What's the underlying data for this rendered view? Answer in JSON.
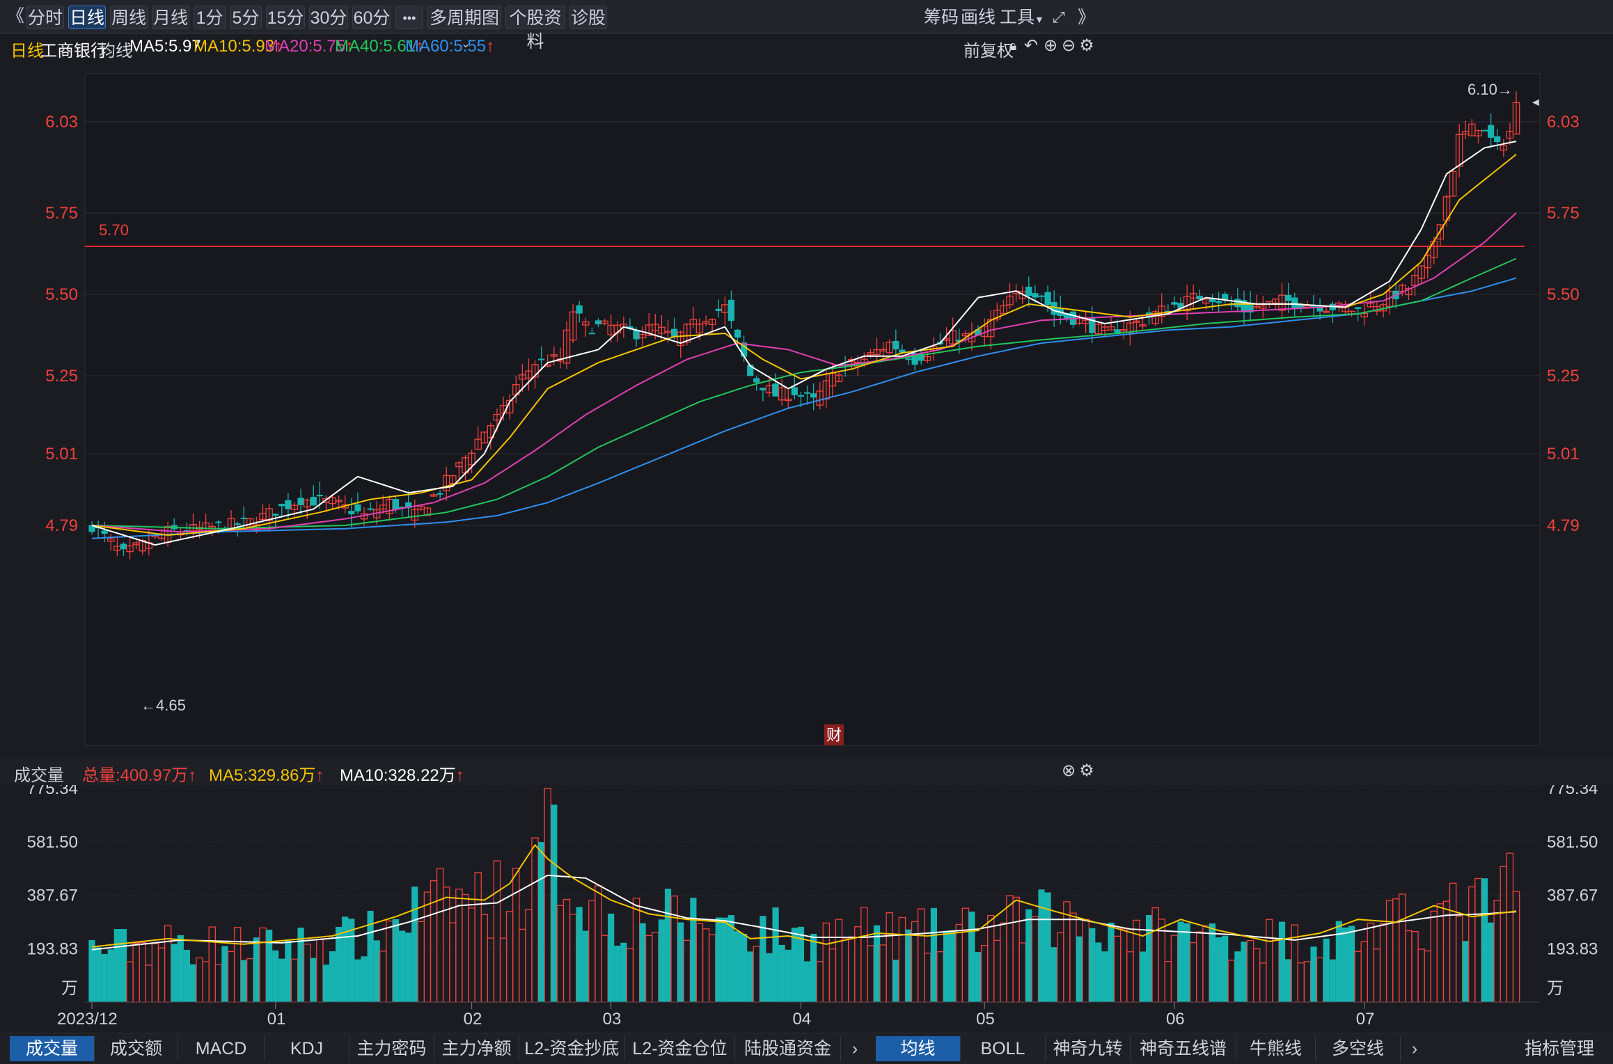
{
  "toolbar": {
    "back_icon": "double-chevron-left",
    "periods": [
      "分时",
      "日线",
      "周线",
      "月线",
      "1分",
      "5分",
      "15分",
      "30分",
      "60分"
    ],
    "active_period": "日线",
    "more": "•••",
    "multi": "多周期图",
    "profile": "个股资料",
    "diagnose": "诊股",
    "right": {
      "chips": "筹码",
      "draw": "画线",
      "tools": "工具"
    }
  },
  "info": {
    "period": "日线",
    "name": "工商银行",
    "ma_label": "均线",
    "ma5": "MA5:5.97",
    "ma10": "MA10:5.93",
    "ma20": "MA20:5.75",
    "ma40": "MA40:5.61",
    "ma60": "MA60:5.55",
    "adjust": "前复权"
  },
  "price_panel": {
    "y_labels": [
      "6.03",
      "5.75",
      "5.50",
      "5.25",
      "5.01",
      "4.79"
    ],
    "hline_label": "5.70",
    "high_label": "6.10→",
    "low_label": "←4.65",
    "fin_badge": "财"
  },
  "volume_bar": {
    "title": "成交量",
    "total": "总量:400.97万",
    "ma5": "MA5:329.86万",
    "ma10": "MA10:328.22万"
  },
  "volume_panel": {
    "y_labels": [
      "775.34",
      "581.50",
      "387.67",
      "193.83",
      "万"
    ]
  },
  "x_axis": [
    "2023/12",
    "01",
    "02",
    "03",
    "04",
    "05",
    "06",
    "07"
  ],
  "bottom_tabs_left": [
    "成交量",
    "成交额",
    "MACD",
    "KDJ",
    "主力密码",
    "主力净额",
    "L2-资金抄底",
    "L2-资金仓位",
    "陆股通资金"
  ],
  "bottom_tabs_right": [
    "均线",
    "BOLL",
    "神奇九转",
    "神奇五线谱",
    "牛熊线",
    "多空线"
  ],
  "indicator_manage": "指标管理",
  "colors": {
    "up": "#f0403c",
    "down": "#17b3b0",
    "ma5": "#ffffff",
    "ma10": "#f5c400",
    "ma20": "#e040b4",
    "ma40": "#22c55e",
    "ma60": "#2f8ff0"
  },
  "chart_data": {
    "type": "candlestick",
    "title": "工商银行 日线",
    "ylim": [
      4.55,
      6.15
    ],
    "ma_anchors": {
      "ma5": [
        [
          0,
          4.79
        ],
        [
          10,
          4.73
        ],
        [
          22,
          4.78
        ],
        [
          35,
          4.84
        ],
        [
          42,
          4.94
        ],
        [
          50,
          4.89
        ],
        [
          57,
          4.91
        ],
        [
          62,
          5.01
        ],
        [
          66,
          5.17
        ],
        [
          72,
          5.29
        ],
        [
          80,
          5.33
        ],
        [
          84,
          5.4
        ],
        [
          88,
          5.38
        ],
        [
          93,
          5.35
        ],
        [
          100,
          5.4
        ],
        [
          104,
          5.28
        ],
        [
          110,
          5.21
        ],
        [
          116,
          5.27
        ],
        [
          122,
          5.31
        ],
        [
          128,
          5.31
        ],
        [
          134,
          5.35
        ],
        [
          140,
          5.49
        ],
        [
          146,
          5.51
        ],
        [
          152,
          5.45
        ],
        [
          160,
          5.41
        ],
        [
          170,
          5.44
        ],
        [
          176,
          5.49
        ],
        [
          184,
          5.47
        ],
        [
          190,
          5.47
        ],
        [
          198,
          5.46
        ],
        [
          205,
          5.54
        ],
        [
          210,
          5.7
        ],
        [
          214,
          5.87
        ],
        [
          220,
          5.95
        ],
        [
          225,
          5.97
        ]
      ],
      "ma10": [
        [
          0,
          4.79
        ],
        [
          12,
          4.76
        ],
        [
          24,
          4.78
        ],
        [
          36,
          4.83
        ],
        [
          44,
          4.87
        ],
        [
          52,
          4.89
        ],
        [
          60,
          4.93
        ],
        [
          66,
          5.06
        ],
        [
          72,
          5.21
        ],
        [
          80,
          5.29
        ],
        [
          86,
          5.33
        ],
        [
          92,
          5.37
        ],
        [
          100,
          5.38
        ],
        [
          106,
          5.3
        ],
        [
          112,
          5.24
        ],
        [
          120,
          5.27
        ],
        [
          128,
          5.32
        ],
        [
          136,
          5.34
        ],
        [
          142,
          5.42
        ],
        [
          148,
          5.47
        ],
        [
          156,
          5.45
        ],
        [
          164,
          5.43
        ],
        [
          172,
          5.45
        ],
        [
          180,
          5.47
        ],
        [
          190,
          5.47
        ],
        [
          198,
          5.46
        ],
        [
          204,
          5.5
        ],
        [
          210,
          5.6
        ],
        [
          216,
          5.79
        ],
        [
          225,
          5.93
        ]
      ],
      "ma20": [
        [
          0,
          4.79
        ],
        [
          14,
          4.77
        ],
        [
          28,
          4.78
        ],
        [
          40,
          4.81
        ],
        [
          54,
          4.86
        ],
        [
          62,
          4.92
        ],
        [
          70,
          5.02
        ],
        [
          78,
          5.13
        ],
        [
          86,
          5.22
        ],
        [
          94,
          5.3
        ],
        [
          102,
          5.35
        ],
        [
          110,
          5.33
        ],
        [
          118,
          5.28
        ],
        [
          126,
          5.3
        ],
        [
          134,
          5.33
        ],
        [
          142,
          5.39
        ],
        [
          150,
          5.42
        ],
        [
          160,
          5.43
        ],
        [
          172,
          5.44
        ],
        [
          184,
          5.45
        ],
        [
          194,
          5.46
        ],
        [
          204,
          5.48
        ],
        [
          212,
          5.55
        ],
        [
          220,
          5.66
        ],
        [
          225,
          5.75
        ]
      ],
      "ma40": [
        [
          0,
          4.79
        ],
        [
          20,
          4.78
        ],
        [
          40,
          4.79
        ],
        [
          56,
          4.83
        ],
        [
          64,
          4.87
        ],
        [
          72,
          4.94
        ],
        [
          80,
          5.03
        ],
        [
          88,
          5.1
        ],
        [
          96,
          5.17
        ],
        [
          104,
          5.22
        ],
        [
          112,
          5.26
        ],
        [
          120,
          5.28
        ],
        [
          130,
          5.31
        ],
        [
          140,
          5.34
        ],
        [
          150,
          5.36
        ],
        [
          162,
          5.38
        ],
        [
          176,
          5.41
        ],
        [
          190,
          5.43
        ],
        [
          200,
          5.44
        ],
        [
          210,
          5.48
        ],
        [
          218,
          5.55
        ],
        [
          225,
          5.61
        ]
      ],
      "ma60": [
        [
          0,
          4.75
        ],
        [
          20,
          4.77
        ],
        [
          40,
          4.78
        ],
        [
          56,
          4.8
        ],
        [
          64,
          4.82
        ],
        [
          72,
          4.86
        ],
        [
          80,
          4.92
        ],
        [
          90,
          5.0
        ],
        [
          100,
          5.08
        ],
        [
          110,
          5.15
        ],
        [
          120,
          5.2
        ],
        [
          130,
          5.26
        ],
        [
          140,
          5.31
        ],
        [
          150,
          5.35
        ],
        [
          160,
          5.37
        ],
        [
          170,
          5.39
        ],
        [
          180,
          5.4
        ],
        [
          190,
          5.42
        ],
        [
          200,
          5.44
        ],
        [
          210,
          5.48
        ],
        [
          218,
          5.51
        ],
        [
          225,
          5.55
        ]
      ]
    },
    "anchors": [
      [
        0,
        4.79
      ],
      [
        5,
        4.7
      ],
      [
        8,
        4.73
      ],
      [
        12,
        4.77
      ],
      [
        18,
        4.78
      ],
      [
        25,
        4.8
      ],
      [
        33,
        4.87
      ],
      [
        38,
        4.86
      ],
      [
        43,
        4.82
      ],
      [
        47,
        4.86
      ],
      [
        51,
        4.82
      ],
      [
        55,
        4.9
      ],
      [
        58,
        4.97
      ],
      [
        62,
        5.08
      ],
      [
        65,
        5.14
      ],
      [
        67,
        5.22
      ],
      [
        70,
        5.29
      ],
      [
        74,
        5.3
      ],
      [
        76,
        5.45
      ],
      [
        78,
        5.4
      ],
      [
        82,
        5.4
      ],
      [
        86,
        5.38
      ],
      [
        89,
        5.4
      ],
      [
        92,
        5.36
      ],
      [
        96,
        5.42
      ],
      [
        100,
        5.46
      ],
      [
        104,
        5.25
      ],
      [
        108,
        5.19
      ],
      [
        111,
        5.2
      ],
      [
        114,
        5.17
      ],
      [
        118,
        5.27
      ],
      [
        122,
        5.3
      ],
      [
        126,
        5.35
      ],
      [
        130,
        5.3
      ],
      [
        136,
        5.37
      ],
      [
        140,
        5.37
      ],
      [
        144,
        5.46
      ],
      [
        147,
        5.52
      ],
      [
        150,
        5.5
      ],
      [
        152,
        5.44
      ],
      [
        156,
        5.42
      ],
      [
        160,
        5.38
      ],
      [
        166,
        5.42
      ],
      [
        170,
        5.46
      ],
      [
        176,
        5.5
      ],
      [
        182,
        5.45
      ],
      [
        188,
        5.48
      ],
      [
        192,
        5.47
      ],
      [
        196,
        5.46
      ],
      [
        200,
        5.45
      ],
      [
        204,
        5.48
      ],
      [
        208,
        5.52
      ],
      [
        211,
        5.6
      ],
      [
        214,
        5.8
      ],
      [
        216,
        5.98
      ],
      [
        219,
        6.02
      ],
      [
        222,
        5.95
      ],
      [
        224,
        6.0
      ],
      [
        225,
        6.08
      ]
    ],
    "vol_anchors": [
      [
        0,
        190
      ],
      [
        10,
        210
      ],
      [
        30,
        200
      ],
      [
        45,
        240
      ],
      [
        50,
        320
      ],
      [
        58,
        370
      ],
      [
        66,
        380
      ],
      [
        70,
        450
      ],
      [
        72,
        580
      ],
      [
        76,
        420
      ],
      [
        82,
        310
      ],
      [
        90,
        300
      ],
      [
        100,
        290
      ],
      [
        104,
        270
      ],
      [
        112,
        230
      ],
      [
        120,
        250
      ],
      [
        130,
        240
      ],
      [
        140,
        260
      ],
      [
        150,
        300
      ],
      [
        156,
        290
      ],
      [
        164,
        260
      ],
      [
        172,
        240
      ],
      [
        180,
        240
      ],
      [
        190,
        220
      ],
      [
        200,
        240
      ],
      [
        210,
        300
      ],
      [
        218,
        330
      ],
      [
        225,
        401
      ]
    ],
    "vol_ma5": [
      [
        0,
        200
      ],
      [
        12,
        230
      ],
      [
        24,
        210
      ],
      [
        38,
        240
      ],
      [
        48,
        310
      ],
      [
        56,
        380
      ],
      [
        62,
        370
      ],
      [
        66,
        430
      ],
      [
        70,
        570
      ],
      [
        72,
        520
      ],
      [
        76,
        450
      ],
      [
        82,
        370
      ],
      [
        88,
        320
      ],
      [
        94,
        300
      ],
      [
        100,
        290
      ],
      [
        104,
        230
      ],
      [
        110,
        240
      ],
      [
        116,
        210
      ],
      [
        124,
        250
      ],
      [
        132,
        240
      ],
      [
        140,
        260
      ],
      [
        146,
        370
      ],
      [
        152,
        330
      ],
      [
        160,
        280
      ],
      [
        166,
        240
      ],
      [
        172,
        300
      ],
      [
        178,
        260
      ],
      [
        186,
        220
      ],
      [
        194,
        250
      ],
      [
        200,
        300
      ],
      [
        206,
        290
      ],
      [
        212,
        350
      ],
      [
        218,
        310
      ],
      [
        225,
        330
      ]
    ],
    "vol_ma10": [
      [
        0,
        190
      ],
      [
        14,
        225
      ],
      [
        30,
        215
      ],
      [
        42,
        240
      ],
      [
        50,
        290
      ],
      [
        58,
        350
      ],
      [
        64,
        360
      ],
      [
        68,
        410
      ],
      [
        72,
        460
      ],
      [
        78,
        450
      ],
      [
        86,
        350
      ],
      [
        94,
        305
      ],
      [
        100,
        295
      ],
      [
        106,
        270
      ],
      [
        114,
        235
      ],
      [
        122,
        235
      ],
      [
        132,
        250
      ],
      [
        140,
        265
      ],
      [
        148,
        300
      ],
      [
        156,
        300
      ],
      [
        164,
        265
      ],
      [
        172,
        255
      ],
      [
        180,
        245
      ],
      [
        190,
        225
      ],
      [
        198,
        250
      ],
      [
        206,
        290
      ],
      [
        214,
        315
      ],
      [
        220,
        320
      ],
      [
        225,
        328
      ]
    ],
    "vol_ylim": [
      0,
      775.34
    ],
    "count": 226
  }
}
